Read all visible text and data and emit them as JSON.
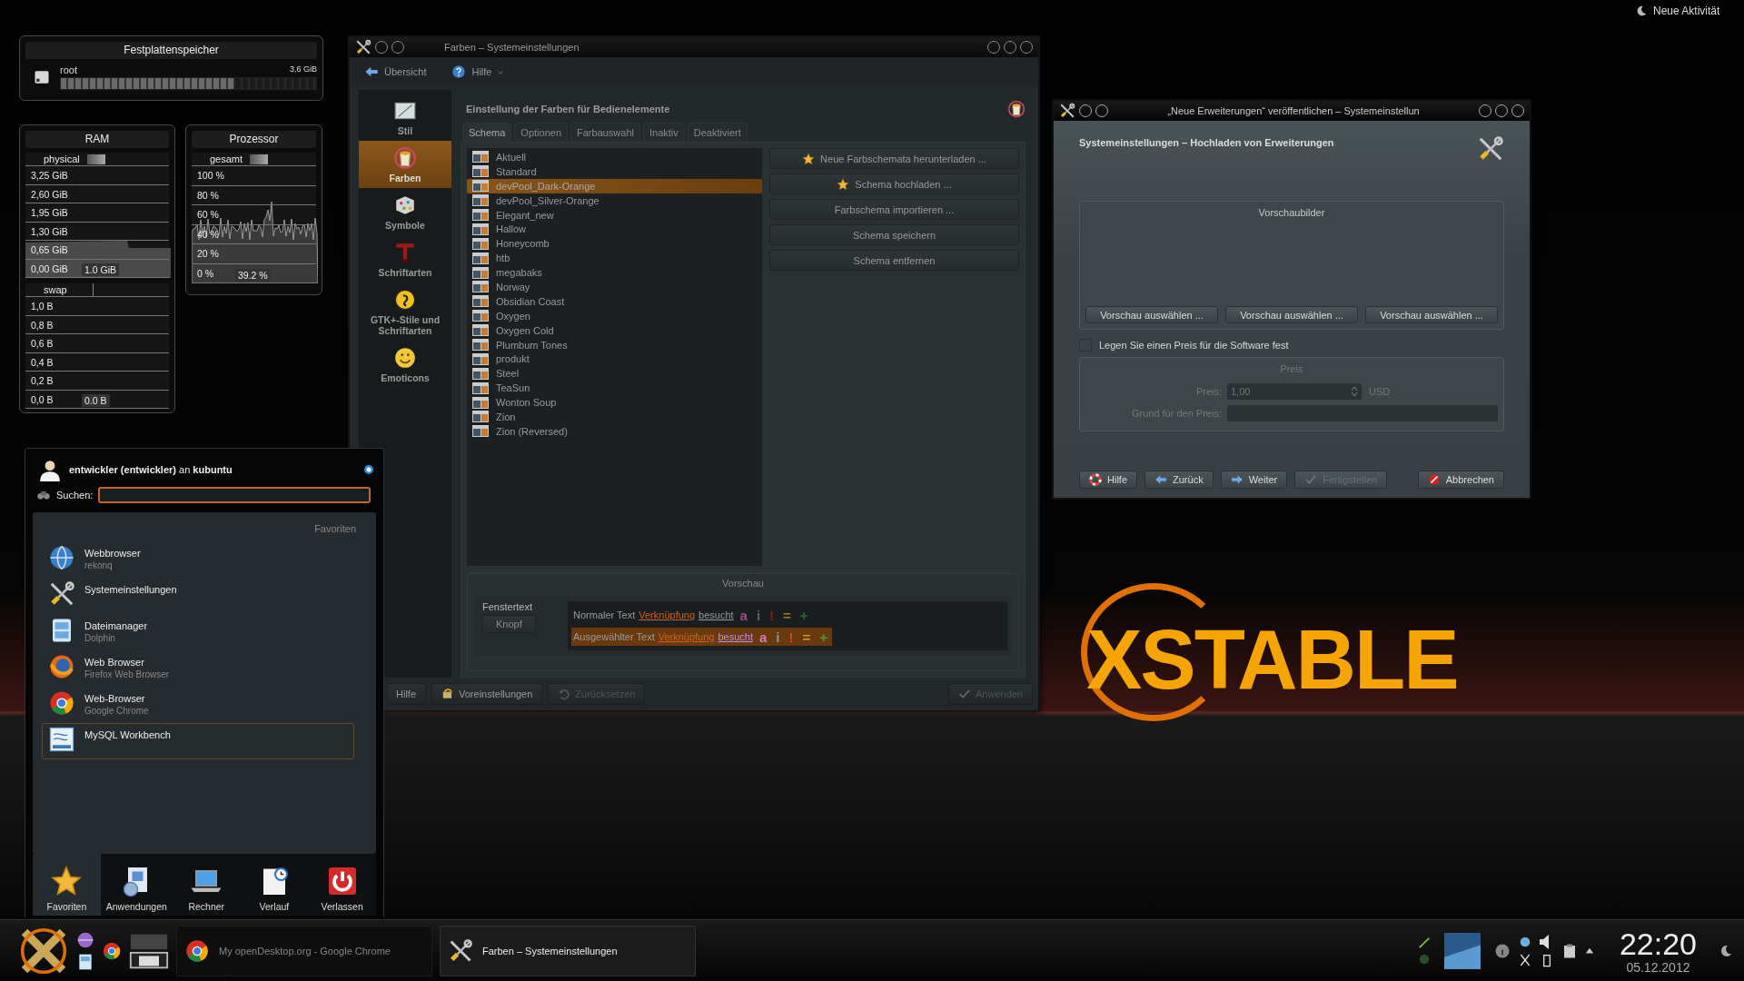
{
  "desktop": {
    "activity_button": "Neue Aktivität",
    "wallpaper_logo": "XSTABLE"
  },
  "disk_widget": {
    "title": "Festplattenspeicher",
    "drives": [
      {
        "name": "root",
        "size": "3,6 GiB",
        "level": 0.68
      }
    ]
  },
  "ram_widget": {
    "title": "RAM",
    "sections": [
      {
        "legend": "physical",
        "ticks": [
          "3,25 GiB",
          "2,60 GiB",
          "1,95 GiB",
          "1,30 GiB",
          "0,65 GiB",
          "0,00 GiB"
        ],
        "reading": "1.0 GiB"
      },
      {
        "legend": "swap",
        "ticks": [
          "1,0 B",
          "0,8 B",
          "0,6 B",
          "0,4 B",
          "0,2 B",
          "0,0 B"
        ],
        "reading": "0.0 B"
      }
    ]
  },
  "cpu_widget": {
    "title": "Prozessor",
    "legend": "gesamt",
    "ticks": [
      "100 %",
      "80 %",
      "60 %",
      "40 %",
      "20 %",
      "0 %"
    ],
    "reading": "39.2 %"
  },
  "launcher": {
    "user": "**entwickler (entwickler)** an **kubuntu**",
    "search_label": "Suchen:",
    "section": "Favoriten",
    "items": [
      {
        "kind": "globe",
        "title": "Webbrowser",
        "subtitle": "rekonq",
        "selected": false
      },
      {
        "kind": "tools",
        "title": "Systemeinstellungen",
        "selected": false
      },
      {
        "kind": "cabinet",
        "title": "Dateimanager",
        "subtitle": "Dolphin",
        "selected": false
      },
      {
        "kind": "fox",
        "title": "Web Browser",
        "subtitle": "Firefox Web Browser",
        "selected": false
      },
      {
        "kind": "wheel",
        "title": "Web-Browser",
        "subtitle": "Google Chrome",
        "selected": false
      },
      {
        "kind": "database",
        "title": "MySQL Workbench",
        "selected": true
      }
    ],
    "tabs": [
      {
        "kind": "star",
        "label": "Favoriten",
        "selected": true
      },
      {
        "kind": "package",
        "label": "Anwendungen",
        "selected": false
      },
      {
        "kind": "laptop",
        "label": "Rechner",
        "selected": false
      },
      {
        "kind": "history",
        "label": "Verlauf",
        "selected": false
      },
      {
        "kind": "power",
        "label": "Verlassen",
        "selected": false
      }
    ]
  },
  "settings_window": {
    "title": "Farben – Systemeinstellungen",
    "toolbar": [
      {
        "kind": "back",
        "label": "Übersicht"
      },
      {
        "kind": "help",
        "label": "Hilfe"
      }
    ],
    "sidebar": [
      {
        "kind": "frame",
        "label": "Stil",
        "selected": false
      },
      {
        "kind": "bucket",
        "label": "Farben",
        "selected": true
      },
      {
        "kind": "cube",
        "label": "Symbole",
        "selected": false
      },
      {
        "kind": "font",
        "label": "Schriftarten",
        "selected": false
      },
      {
        "kind": "foot",
        "label": "GTK+-Stile und Schriftarten",
        "selected": false
      },
      {
        "kind": "smiley",
        "label": "Emoticons",
        "selected": false
      }
    ],
    "heading": "Einstellung der Farben für Bedienelemente",
    "tabs": [
      {
        "label": "Schema",
        "selected": true
      },
      {
        "label": "Optionen",
        "selected": false
      },
      {
        "label": "Farbauswahl",
        "selected": false
      },
      {
        "label": "Inaktiv",
        "selected": false
      },
      {
        "label": "Deaktiviert",
        "selected": false
      }
    ],
    "schemes": [
      {
        "name": "Aktuell",
        "selected": false
      },
      {
        "name": "Standard",
        "selected": false
      },
      {
        "name": "devPool_Dark-Orange",
        "selected": true
      },
      {
        "name": "devPool_Silver-Orange",
        "selected": false
      },
      {
        "name": "Elegant_new",
        "selected": false
      },
      {
        "name": "Hallow",
        "selected": false
      },
      {
        "name": "Honeycomb",
        "selected": false
      },
      {
        "name": "htb",
        "selected": false
      },
      {
        "name": "megabaks",
        "selected": false
      },
      {
        "name": "Norway",
        "selected": false
      },
      {
        "name": "Obsidian Coast",
        "selected": false
      },
      {
        "name": "Oxygen",
        "selected": false
      },
      {
        "name": "Oxygen Cold",
        "selected": false
      },
      {
        "name": "Plumbum Tones",
        "selected": false
      },
      {
        "name": "produkt",
        "selected": false
      },
      {
        "name": "Steel",
        "selected": false
      },
      {
        "name": "TeaSun",
        "selected": false
      },
      {
        "name": "Wonton Soup",
        "selected": false
      },
      {
        "name": "Zion",
        "selected": false
      },
      {
        "name": "Zion (Reversed)",
        "selected": false
      }
    ],
    "actions": [
      {
        "kind": "star",
        "label": "Neue Farbschemata herunterladen ..."
      },
      {
        "kind": "star",
        "label": "Schema hochladen ..."
      },
      {
        "kind": "plain",
        "label": "Farbschema importieren ..."
      },
      {
        "kind": "plain",
        "label": "Schema speichern"
      },
      {
        "kind": "plain",
        "label": "Schema entfernen"
      }
    ],
    "preview": {
      "title": "Vorschau",
      "window_text": "Fenstertext",
      "button": "Knopf",
      "rows": [
        {
          "kind": "normal",
          "text": "Normaler Text",
          "link": "Verknüpfung",
          "visited": "besucht",
          "marks": [
            {
              "text": "a",
              "color": "#a0508a"
            },
            {
              "text": "i",
              "color": "#606060"
            },
            {
              "text": "!",
              "color": "#7a2020"
            },
            {
              "text": "=",
              "color": "#a08020"
            },
            {
              "text": "+",
              "color": "#2a6a2a"
            }
          ]
        },
        {
          "kind": "selected",
          "text": "Ausgewählter Text",
          "link": "Verknüpfung",
          "visited": "besucht",
          "marks": [
            {
              "text": "a",
              "color": "#d080b0"
            },
            {
              "text": "i",
              "color": "#909090"
            },
            {
              "text": "!",
              "color": "#d04040"
            },
            {
              "text": "=",
              "color": "#d0a030"
            },
            {
              "text": "+",
              "color": "#40a040"
            }
          ]
        }
      ]
    },
    "footer": [
      {
        "kind": "help",
        "label": "Hilfe",
        "disabled": false
      },
      {
        "kind": "defaults",
        "label": "Voreinstellungen",
        "disabled": false
      },
      {
        "kind": "reset",
        "label": "Zurücksetzen",
        "disabled": true
      },
      {
        "kind": "apply",
        "label": "Anwenden",
        "disabled": true
      }
    ]
  },
  "dialog": {
    "title": "„Neue Erweiterungen“ veröffentlichen – Systemeinstellun",
    "heading": "Systemeinstellungen – Hochladen von Erweiterungen",
    "previews": {
      "title": "Vorschaubilder",
      "buttons": [
        "Vorschau auswählen ...",
        "Vorschau auswählen ...",
        "Vorschau auswählen ..."
      ]
    },
    "price_checkbox": {
      "label": "Legen Sie einen Preis für die Software fest",
      "checked": false
    },
    "price_group": {
      "title": "Preis",
      "disabled": true,
      "price_label": "Preis:",
      "price_value": "1,00",
      "currency": "USD",
      "reason_label": "Grund für den Preis:"
    },
    "buttons": [
      {
        "kind": "help",
        "label": "Hilfe",
        "disabled": false
      },
      {
        "kind": "back",
        "label": "Zurück",
        "disabled": false
      },
      {
        "kind": "next",
        "label": "Weiter",
        "disabled": false
      },
      {
        "kind": "finish",
        "label": "Fertigstellen",
        "disabled": true
      },
      {
        "kind": "cancel",
        "label": "Abbrechen",
        "disabled": false
      }
    ]
  },
  "taskbar": {
    "tasks": [
      {
        "kind": "wheel",
        "label": "My openDesktop.org - Google Chrome",
        "active": false
      },
      {
        "kind": "tools",
        "label": "Farben – Systemeinstellungen",
        "active": true
      }
    ],
    "clock": {
      "time": "22:20",
      "date": "05.12.2012"
    }
  }
}
